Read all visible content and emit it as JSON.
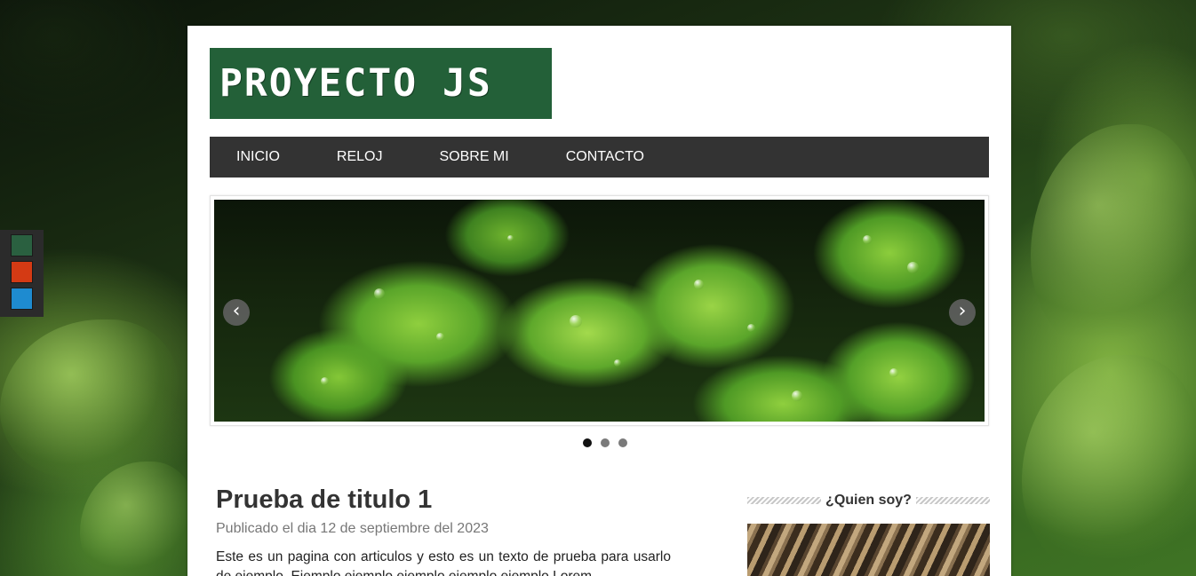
{
  "theme_switcher": {
    "colors": [
      "#2a6040",
      "#d43a14",
      "#1e8bd0"
    ]
  },
  "header": {
    "logo_text": "PROYECTO JS",
    "logo_bg": "#236038"
  },
  "nav": {
    "items": [
      "INICIO",
      "RELOJ",
      "SOBRE MI",
      "CONTACTO"
    ]
  },
  "slider": {
    "prev_glyph": "‹",
    "next_glyph": "›",
    "slide_count": 3,
    "active_slide": 1
  },
  "article": {
    "title": "Prueba de titulo 1",
    "date": "Publicado el dia 12 de septiembre del 2023",
    "body": "Este es un pagina con articulos y esto es un texto de prueba para usarlo de ejemplo. Ejemplo ejemplo ejemplo ejemplo ejemplo Lorem"
  },
  "sidebar": {
    "widget_title": "¿Quien soy?"
  }
}
